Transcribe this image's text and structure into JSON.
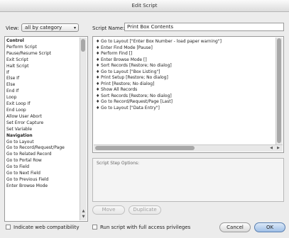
{
  "window": {
    "title": "Edit Script"
  },
  "view": {
    "label": "View:",
    "selected": "all by category"
  },
  "script_name": {
    "label": "Script Name:",
    "value": "Print Box Contents"
  },
  "steps": [
    {
      "label": "Control",
      "category": true
    },
    {
      "label": "Perform Script"
    },
    {
      "label": "Pause/Resume Script"
    },
    {
      "label": "Exit Script"
    },
    {
      "label": "Halt Script"
    },
    {
      "label": "If"
    },
    {
      "label": "Else If"
    },
    {
      "label": "Else"
    },
    {
      "label": "End If"
    },
    {
      "label": "Loop"
    },
    {
      "label": "Exit Loop If"
    },
    {
      "label": "End Loop"
    },
    {
      "label": "Allow User Abort"
    },
    {
      "label": "Set Error Capture"
    },
    {
      "label": "Set Variable"
    },
    {
      "label": "Navigation",
      "category": true
    },
    {
      "label": "Go to Layout"
    },
    {
      "label": "Go to Record/Request/Page"
    },
    {
      "label": "Go to Related Record"
    },
    {
      "label": "Go to Portal Row"
    },
    {
      "label": "Go to Field"
    },
    {
      "label": "Go to Next Field"
    },
    {
      "label": "Go to Previous Field"
    },
    {
      "label": "Enter Browse Mode"
    }
  ],
  "script_lines": [
    "Go to Layout [\"Enter Box Number - load paper warning\"]",
    "Enter Find Mode [Pause]",
    "Perform Find []",
    "Enter Browse Mode []",
    "Sort Records [Restore; No dialog]",
    "Go to Layout [\"Box Listing\"]",
    "Print Setup [Restore; No dialog]",
    "Print [Restore; No dialog]",
    "Show All Records",
    "Sort Records [Restore; No dialog]",
    "Go to Record/Request/Page [Last]",
    "Go to Layout [\"Data Entry\"]"
  ],
  "options": {
    "label": "Script Step Options:"
  },
  "buttons": {
    "move": "Move",
    "duplicate": "Duplicate",
    "cancel": "Cancel",
    "ok": "OK"
  },
  "checkboxes": {
    "web": "Indicate web compatibility",
    "full_access": "Run script with full access privileges"
  }
}
